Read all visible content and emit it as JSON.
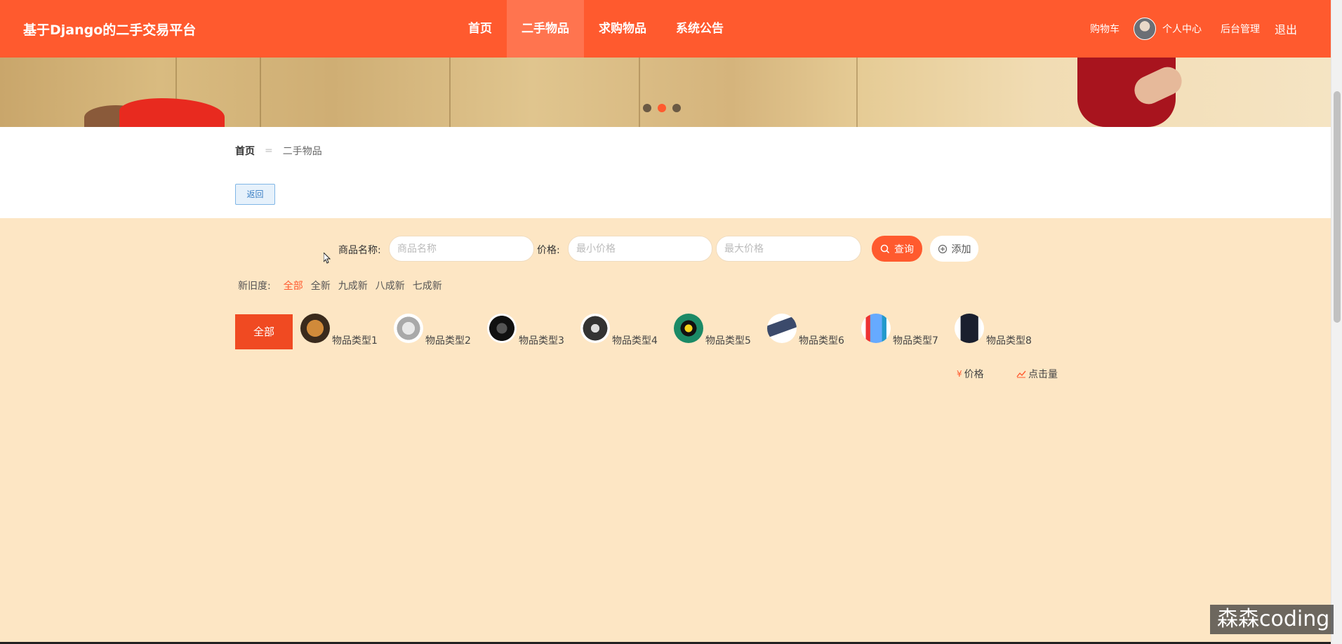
{
  "brand": "基于Django的二手交易平台",
  "nav": [
    {
      "label": "首页",
      "active": false
    },
    {
      "label": "二手物品",
      "active": true
    },
    {
      "label": "求购物品",
      "active": false
    },
    {
      "label": "系统公告",
      "active": false
    }
  ],
  "header_right": {
    "cart": "购物车",
    "center": "个人中心",
    "admin": "后台管理",
    "logout": "退出"
  },
  "banner": {
    "slides": 3,
    "active_slide": 2
  },
  "breadcrumb": {
    "home": "首页",
    "separator": "=",
    "current": "二手物品"
  },
  "back_button": "返回",
  "search": {
    "name_label": "商品名称:",
    "name_placeholder": "商品名称",
    "price_label": "价格:",
    "min_placeholder": "最小价格",
    "max_placeholder": "最大价格",
    "query_label": "查询",
    "add_label": "添加"
  },
  "condition": {
    "label": "新旧度:",
    "options": [
      "全部",
      "全新",
      "九成新",
      "八成新",
      "七成新"
    ],
    "active": "全部"
  },
  "categories": {
    "all_label": "全部",
    "items": [
      "物品类型1",
      "物品类型2",
      "物品类型3",
      "物品类型4",
      "物品类型5",
      "物品类型6",
      "物品类型7",
      "物品类型8"
    ]
  },
  "sort": {
    "price": "价格",
    "clicks": "点击量"
  },
  "watermark": "森森coding",
  "colors": {
    "accent": "#ff5a2e",
    "background": "#fde6c4"
  }
}
